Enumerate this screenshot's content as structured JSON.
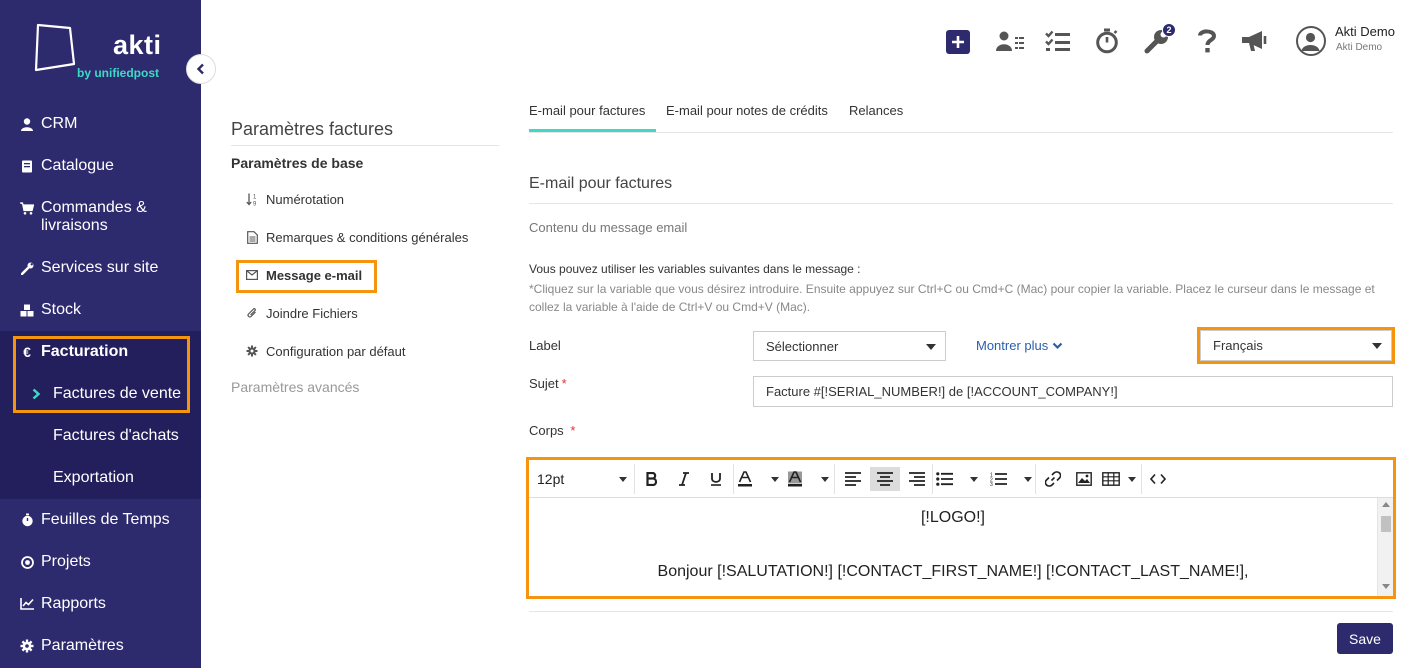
{
  "brand": {
    "name": "akti",
    "tagline": "by unifiedpost",
    "accent": "#3ddbc6",
    "primary": "#2e2a6e",
    "highlight": "#f5950f"
  },
  "sidebar": {
    "items": [
      {
        "label": "CRM",
        "icon": "user-icon"
      },
      {
        "label": "Catalogue",
        "icon": "book-icon"
      },
      {
        "label": "Commandes & livraisons",
        "icon": "cart-icon"
      },
      {
        "label": "Services sur site",
        "icon": "wrench-icon"
      },
      {
        "label": "Stock",
        "icon": "cubes-icon"
      },
      {
        "label": "Facturation",
        "icon": "euro-icon"
      },
      {
        "label": "Feuilles de Temps",
        "icon": "stopwatch-icon"
      },
      {
        "label": "Projets",
        "icon": "target-icon"
      },
      {
        "label": "Rapports",
        "icon": "chart-icon"
      },
      {
        "label": "Paramètres",
        "icon": "gear-icon"
      }
    ],
    "facturation_sub": [
      {
        "label": "Factures de vente",
        "active": true
      },
      {
        "label": "Factures d'achats"
      },
      {
        "label": "Exportation"
      }
    ]
  },
  "topbar": {
    "notifications_badge": "2",
    "user": {
      "name": "Akti Demo",
      "company": "Akti Demo"
    }
  },
  "settings_menu": {
    "title": "Paramètres factures",
    "section": "Paramètres de base",
    "items": [
      {
        "label": "Numérotation",
        "icon": "sort-numeric-icon"
      },
      {
        "label": "Remarques & conditions générales",
        "icon": "document-icon"
      },
      {
        "label": "Message e-mail",
        "icon": "envelope-icon",
        "active": true
      },
      {
        "label": "Joindre Fichiers",
        "icon": "paperclip-icon"
      },
      {
        "label": "Configuration par défaut",
        "icon": "cog-icon"
      }
    ],
    "advanced": "Paramètres avancés"
  },
  "tabs": [
    {
      "label": "E-mail pour factures",
      "active": true
    },
    {
      "label": "E-mail pour notes de crédits"
    },
    {
      "label": "Relances"
    }
  ],
  "main": {
    "section_title": "E-mail pour factures",
    "content_label": "Contenu du message email",
    "instructions": "Vous pouvez utiliser les variables suivantes dans le message :",
    "instructions_hint": "*Cliquez sur la variable que vous désirez introduire. Ensuite appuyez sur Ctrl+C ou Cmd+C (Mac) pour copier la variable. Placez le curseur dans le message et collez la variable à l'aide de Ctrl+V ou Cmd+V (Mac).",
    "label_field": {
      "label": "Label",
      "value": "Sélectionner"
    },
    "show_more": "Montrer plus",
    "language": {
      "value": "Français"
    },
    "subject": {
      "label": "Sujet",
      "required_mark": "*",
      "value": "Facture #[!SERIAL_NUMBER!] de [!ACCOUNT_COMPANY!]"
    },
    "body": {
      "label": "Corps",
      "required_mark": "*",
      "font_size": "12pt",
      "lines": [
        "[!LOGO!]",
        "Bonjour [!SALUTATION!] [!CONTACT_FIRST_NAME!] [!CONTACT_LAST_NAME!],"
      ]
    },
    "save_label": "Save"
  }
}
